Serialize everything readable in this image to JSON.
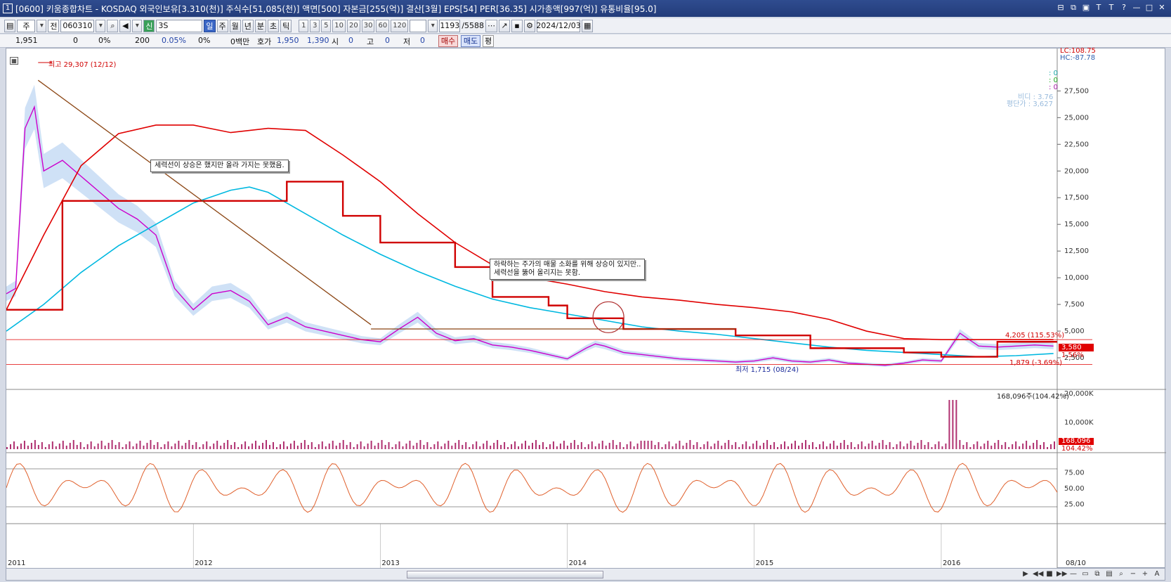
{
  "titlebar": {
    "window_number": "1",
    "title": "[0600] 키움종합차트 - KOSDAQ 외국인보유[3.310(천)] 주식수[51,085(천)] 액면[500] 자본금[255(억)] 결산[3월] EPS[54] PER[36.35] 시가총액[997(억)] 유통비율[95.0]"
  },
  "toolbar": {
    "type_label": "주",
    "whole_label": "전",
    "code": "060310",
    "search_value": "3S",
    "period_buttons": [
      "일",
      "주",
      "월",
      "년",
      "분",
      "초",
      "틱"
    ],
    "selected_period": "일",
    "minute_buttons": [
      "1",
      "3",
      "5",
      "10",
      "20",
      "30",
      "60",
      "120"
    ],
    "count": "1193",
    "count_total": "/5588",
    "date": "2024/12/03"
  },
  "quote": {
    "price": "1,951",
    "change": "0",
    "change_pct": "0%",
    "qty": "200",
    "qty_pct": "0.05%",
    "zero_pct": "0%",
    "amount": "0백만",
    "ask_label": "호가",
    "ask": "1,950",
    "bid": "1,390",
    "open_label": "시",
    "open": "0",
    "high_label": "고",
    "high": "0",
    "low_label": "저",
    "low": "0",
    "buy": "매수",
    "sell": "매도",
    "eval": "평"
  },
  "chart_labels": {
    "high_mark": "최고 29,307 (12/12)",
    "low_mark": "최저 1,715 (08/24)",
    "lc": "LC:108.75",
    "hc": "HC:-87.78",
    "level1": "4,205 (115.53%)",
    "level2": "1,879 (-3.69%)",
    "current_price": "3,580",
    "current_pct": "1.56%",
    "volume_max": "168,096주(104.42%)",
    "volume_current": "168,096",
    "volume_pct": "104.42%",
    "annotation1": "세력선이 상승은 했지만 올라 가지는 못했음.",
    "annotation2_line1": "하락하는 주가의 매물 소화를 위해 상승이 있지만..",
    "annotation2_line2": "세력선을 뚫어 올리지는 못함.",
    "legend_zero1": ": 0",
    "legend_zero2": ": 0",
    "legend_zero3": ": 0",
    "legend_ratio": "비디 : 3.76",
    "legend_avg": "평단가 : 3,627"
  },
  "chart_data": {
    "type": "line",
    "price_axis": {
      "ticks": [
        "27,500",
        "25,000",
        "22,500",
        "20,000",
        "17,500",
        "15,000",
        "12,500",
        "10,000",
        "7,500",
        "5,000",
        "2,500"
      ],
      "values": [
        27500,
        25000,
        22500,
        20000,
        17500,
        15000,
        12500,
        10000,
        7500,
        5000,
        2500
      ]
    },
    "volume_axis": {
      "ticks": [
        "20,000K",
        "10,000K"
      ]
    },
    "stoch_axis": {
      "ticks": [
        "75.00",
        "50.00",
        "25.00"
      ]
    },
    "x_axis": {
      "ticks": [
        "2011",
        "2012",
        "2013",
        "2014",
        "2015",
        "2016",
        "08/10"
      ]
    },
    "series": [
      {
        "name": "",
        "color": "#cc00cc",
        "x": [
          2011.0,
          2011.05,
          2011.1,
          2011.15,
          2011.2,
          2011.3,
          2011.4,
          2011.5,
          2011.6,
          2011.7,
          2011.8,
          2011.9,
          2012.0,
          2012.1,
          2012.2,
          2012.3,
          2012.4,
          2012.5,
          2012.6,
          2012.7,
          2012.8,
          2012.9,
          2013.0,
          2013.1,
          2013.2,
          2013.3,
          2013.4,
          2013.5,
          2013.6,
          2013.7,
          2013.8,
          2013.9,
          2014.0,
          2014.1,
          2014.15,
          2014.2,
          2014.3,
          2014.4,
          2014.5,
          2014.6,
          2014.7,
          2014.8,
          2014.9,
          2015.0,
          2015.1,
          2015.2,
          2015.3,
          2015.4,
          2015.5,
          2015.6,
          2015.7,
          2015.8,
          2015.9,
          2016.0,
          2016.1,
          2016.2,
          2016.3,
          2016.4,
          2016.5,
          2016.6
        ],
        "y": [
          8500,
          9000,
          24000,
          26000,
          20000,
          21000,
          19500,
          18000,
          16500,
          15500,
          14000,
          9000,
          7000,
          8500,
          8800,
          7800,
          5600,
          6300,
          5400,
          5000,
          4600,
          4200,
          4000,
          5200,
          6300,
          4800,
          4100,
          4300,
          3700,
          3500,
          3200,
          2800,
          2400,
          3400,
          3800,
          3600,
          3000,
          2800,
          2600,
          2400,
          2300,
          2200,
          2100,
          2200,
          2500,
          2200,
          2100,
          2300,
          2000,
          1900,
          1800,
          2000,
          2300,
          2200,
          4800,
          3600,
          3500,
          3600,
          3700,
          3600
        ]
      },
      {
        "name": "",
        "color": "#e00000",
        "x": [
          2011.0,
          2011.2,
          2011.4,
          2011.6,
          2011.8,
          2012.0,
          2012.2,
          2012.4,
          2012.6,
          2012.8,
          2013.0,
          2013.2,
          2013.4,
          2013.6,
          2013.8,
          2014.0,
          2014.2,
          2014.4,
          2014.6,
          2014.8,
          2015.0,
          2015.2,
          2015.4,
          2015.6,
          2015.8,
          2016.0,
          2016.2,
          2016.4,
          2016.6
        ],
        "y": [
          7000,
          14000,
          20500,
          23500,
          24300,
          24300,
          23600,
          24000,
          23800,
          21500,
          19000,
          16000,
          13300,
          11200,
          10000,
          9400,
          8700,
          8200,
          7900,
          7500,
          7200,
          6800,
          6100,
          5000,
          4300,
          4200,
          4200,
          4200,
          4200
        ]
      },
      {
        "name": "",
        "color": "#00b8e0",
        "x": [
          2011.0,
          2011.2,
          2011.4,
          2011.6,
          2011.8,
          2012.0,
          2012.2,
          2012.3,
          2012.4,
          2012.6,
          2012.8,
          2013.0,
          2013.2,
          2013.4,
          2013.6,
          2013.8,
          2014.0,
          2014.2,
          2014.4,
          2014.6,
          2014.8,
          2015.0,
          2015.2,
          2015.4,
          2015.6,
          2015.8,
          2016.0,
          2016.2,
          2016.4,
          2016.6
        ],
        "y": [
          5000,
          7500,
          10500,
          13000,
          15000,
          17000,
          18200,
          18500,
          18000,
          16000,
          14000,
          12200,
          10600,
          9200,
          8000,
          7200,
          6600,
          6000,
          5400,
          5000,
          4700,
          4300,
          3900,
          3500,
          3200,
          3000,
          2800,
          2600,
          2700,
          2900
        ]
      }
    ],
    "ylim": [
      0,
      29500
    ]
  }
}
